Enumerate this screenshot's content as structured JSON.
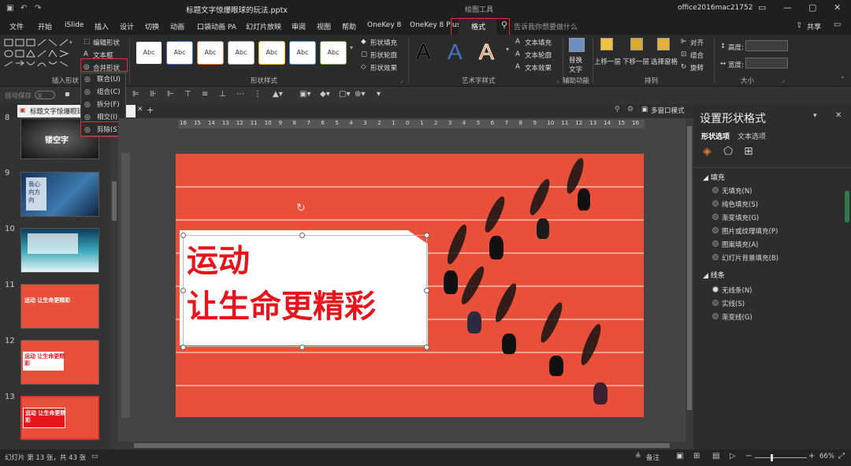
{
  "window": {
    "title": "标题文字惊爆眼球的玩法.pptx",
    "context_tool": "绘图工具",
    "account": "office2016mac21752"
  },
  "tabs": [
    "文件",
    "开始",
    "iSlide",
    "插入",
    "设计",
    "切换",
    "动画",
    "口袋动画 PA",
    "幻灯片放映",
    "审阅",
    "视图",
    "帮助",
    "OneKey 8",
    "OneKey 8 Plus",
    "格式"
  ],
  "active_tab": "格式",
  "tell_me": "告诉我你想要做什么",
  "share": "共享",
  "ribbon": {
    "edit_shape": "编辑形状",
    "textbox": "文本框",
    "merge_shape": "合并形状",
    "group_insert": "插入形状",
    "group_style": "形状样式",
    "style_box": "Abc",
    "shape_fill": "形状填充",
    "shape_outline": "形状轮廓",
    "shape_effect": "形状效果",
    "group_art": "艺术字样式",
    "art_letter": "A",
    "text_fill": "文本填充",
    "text_outline": "文本轮廓",
    "text_effect": "文本效果",
    "replace_text": "替换",
    "replace_text2": "文字",
    "group_aux": "辅助功能",
    "bring_forward": "上移一层",
    "send_backward": "下移一层",
    "selection_pane": "选择窗格",
    "align": "对齐",
    "group": "组合",
    "rotate": "旋转",
    "group_arrange": "排列",
    "height_label": "高度:",
    "width_label": "宽度:",
    "group_size": "大小"
  },
  "merge_menu": [
    "联合(U)",
    "组合(C)",
    "拆分(F)",
    "相交(I)",
    "剪除(S)"
  ],
  "autosave": "自动保存",
  "autosave_state": "关",
  "doc_tab": "标题文字惊爆眼球的...",
  "multiwindow": "多窗口模式",
  "ruler_labels": [
    "16",
    "15",
    "14",
    "13",
    "12",
    "11",
    "10",
    "9",
    "8",
    "7",
    "6",
    "5",
    "4",
    "3",
    "2",
    "1",
    "0",
    "1",
    "2",
    "3",
    "4",
    "5",
    "6",
    "7",
    "8",
    "9",
    "10",
    "11",
    "12",
    "13",
    "14",
    "15",
    "16"
  ],
  "thumbnails": [
    {
      "num": "8",
      "caption": "镂空字"
    },
    {
      "num": "9",
      "caption": "我心向方向"
    },
    {
      "num": "10",
      "caption": ""
    },
    {
      "num": "11",
      "caption": "运动 让生命更精彩"
    },
    {
      "num": "12",
      "caption": "运动 让生命更精彩"
    },
    {
      "num": "13",
      "caption": "运动 让生命更精彩"
    }
  ],
  "slide": {
    "line1": "运动",
    "line2": "让生命更精彩"
  },
  "panel": {
    "title": "设置形状格式",
    "tab_shape": "形状选项",
    "tab_text": "文本选项",
    "fill_header": "填充",
    "fill_options": [
      "无填充(N)",
      "纯色填充(S)",
      "渐变填充(G)",
      "图片或纹理填充(P)",
      "图案填充(A)",
      "幻灯片背景填充(B)"
    ],
    "line_header": "线条",
    "line_options": [
      "无线条(N)",
      "实线(S)",
      "渐变线(G)"
    ]
  },
  "status": {
    "slide_info": "幻灯片 第 13 张，共 43 张",
    "notes": "备注",
    "zoom": "66%"
  },
  "colors": {
    "accent_red": "#e0312f",
    "track": "#e8503a",
    "slide_text": "#e8141b"
  }
}
